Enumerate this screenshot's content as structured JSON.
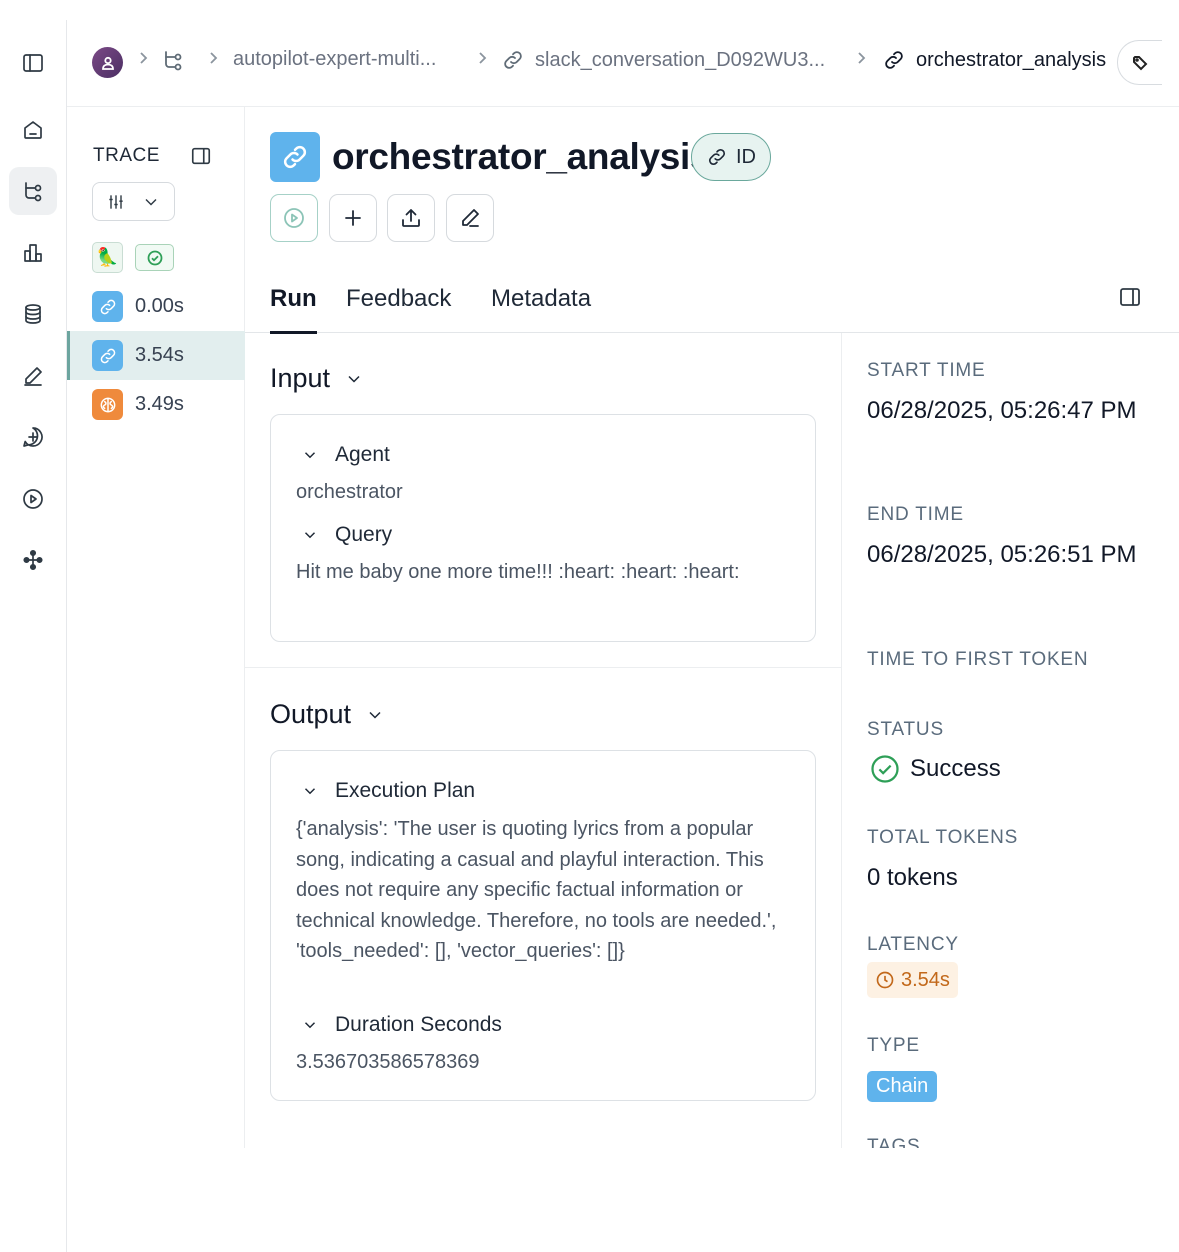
{
  "breadcrumb": {
    "items": [
      {
        "label": "autopilot-expert-multi..."
      },
      {
        "label": "slack_conversation_D092WU3..."
      },
      {
        "label": "orchestrator_analysis"
      }
    ]
  },
  "trace": {
    "title": "TRACE",
    "rows": [
      {
        "duration": "0.00s",
        "kind": "chain"
      },
      {
        "duration": "3.54s",
        "kind": "chain",
        "selected": true
      },
      {
        "duration": "3.49s",
        "kind": "llm"
      }
    ]
  },
  "run": {
    "title": "orchestrator_analysis",
    "id_label": "ID"
  },
  "tabs": [
    "Run",
    "Feedback",
    "Metadata"
  ],
  "input": {
    "heading": "Input",
    "fields": [
      {
        "key": "Agent",
        "value": "orchestrator"
      },
      {
        "key": "Query",
        "value": "Hit me baby one more time!!! :heart: :heart: :heart:"
      }
    ]
  },
  "output": {
    "heading": "Output",
    "fields": [
      {
        "key": "Execution Plan",
        "value": "{'analysis': 'The user is quoting lyrics from a popular song, indicating a casual and playful interaction. This does not require any specific factual information or technical knowledge. Therefore, no tools are needed.', 'tools_needed': [], 'vector_queries': []}"
      },
      {
        "key": "Duration Seconds",
        "value": "3.536703586578369"
      }
    ]
  },
  "meta": {
    "start_time_label": "START TIME",
    "start_time": "06/28/2025, 05:26:47 PM",
    "end_time_label": "END TIME",
    "end_time": "06/28/2025, 05:26:51 PM",
    "ttft_label": "TIME TO FIRST TOKEN",
    "status_label": "STATUS",
    "status": "Success",
    "tokens_label": "TOTAL TOKENS",
    "tokens": "0 tokens",
    "latency_label": "LATENCY",
    "latency": "3.54s",
    "type_label": "TYPE",
    "type": "Chain",
    "tags_label": "TAGS"
  },
  "colors": {
    "chain": "#5fb3ec",
    "llm": "#ef8a3c",
    "success": "#2e9f57",
    "latency": "#c2681a",
    "selected_row": "#e2eeee"
  }
}
